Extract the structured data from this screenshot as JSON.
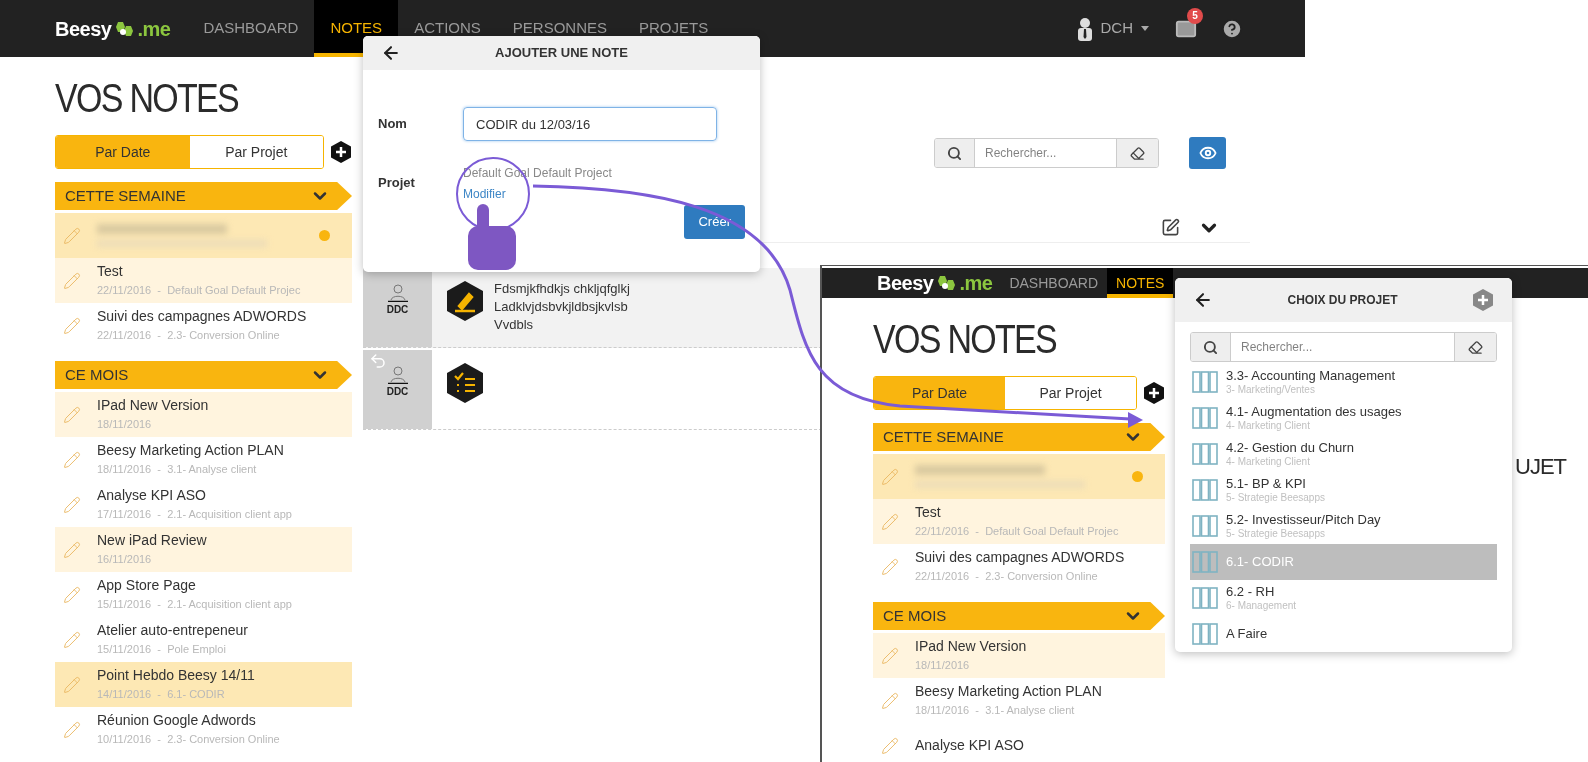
{
  "main_screen": {
    "nav": {
      "logo": {
        "name": "Beesy",
        "suffix": ".me"
      },
      "items": [
        {
          "label": "DASHBOARD",
          "selected": false
        },
        {
          "label": "NOTES",
          "selected": true
        },
        {
          "label": "ACTIONS",
          "selected": false
        },
        {
          "label": "PERSONNES",
          "selected": false
        },
        {
          "label": "PROJETS",
          "selected": false
        }
      ],
      "user": "DCH",
      "mail_badge": "5"
    },
    "notes_panel": {
      "title": "VOS NOTES",
      "toggle": [
        {
          "label": "Par Date",
          "selected": true
        },
        {
          "label": "Par Projet",
          "selected": false
        }
      ],
      "sections": [
        {
          "title": "CETTE SEMAINE",
          "expanded": true,
          "notes": [
            {
              "kind": "blurred",
              "selected": true,
              "tinted": true,
              "unread": true
            },
            {
              "kind": "note",
              "title": "Test",
              "meta": "22/11/2016  -  Default Goal Default Projec",
              "selected": false,
              "tinted": true,
              "unread": false
            },
            {
              "kind": "note",
              "title": "Suivi des campagnes ADWORDS",
              "meta": "22/11/2016  -  2.3- Conversion Online",
              "selected": false,
              "tinted": false,
              "unread": false
            }
          ]
        },
        {
          "title": "CE MOIS",
          "expanded": true,
          "notes": [
            {
              "kind": "note",
              "title": "IPad New Version",
              "meta": "18/11/2016",
              "selected": false,
              "tinted": true,
              "unread": false
            },
            {
              "kind": "note",
              "title": "Beesy Marketing Action PLAN",
              "meta": "18/11/2016  -  3.1- Analyse client",
              "selected": false,
              "tinted": false,
              "unread": false
            },
            {
              "kind": "note",
              "title": "Analyse KPI ASO",
              "meta": "17/11/2016  -  2.1- Acquisition client app",
              "selected": false,
              "tinted": false,
              "unread": false
            },
            {
              "kind": "note",
              "title": "New iPad Review",
              "meta": "16/11/2016",
              "selected": false,
              "tinted": true,
              "unread": false
            },
            {
              "kind": "note",
              "title": "App Store Page",
              "meta": "15/11/2016  -  2.1- Acquisition client app",
              "selected": false,
              "tinted": false,
              "unread": false
            },
            {
              "kind": "note",
              "title": "Atelier auto-entrepeneur",
              "meta": "15/11/2016  -  Pole Emploi",
              "selected": false,
              "tinted": false,
              "unread": false
            },
            {
              "kind": "note",
              "title": "Point Hebdo Beesy 14/11",
              "meta": "14/11/2016  -  6.1- CODIR",
              "selected": true,
              "tinted": true,
              "unread": false
            },
            {
              "kind": "note",
              "title": "Réunion Google Adwords",
              "meta": "10/11/2016  -  2.3- Conversion Online",
              "selected": false,
              "tinted": false,
              "unread": false
            }
          ]
        }
      ]
    },
    "search": {
      "placeholder": "Rechercher..."
    },
    "note_rows": [
      {
        "author": "DDC",
        "kind": "note",
        "reply": false,
        "lines": [
          "Fdsmjkfhdkjs chkljqfglkj",
          "Ladklvjdsbvkjldbsjkvlsb",
          "Vvdbls"
        ]
      },
      {
        "author": "DDC",
        "kind": "action",
        "reply": true
      }
    ]
  },
  "add_note_dialog": {
    "title": "AJOUTER UNE NOTE",
    "name_label": "Nom",
    "name_value": "CODIR du 12/03/16",
    "project_label": "Projet",
    "project_value": "Default Goal Default Project",
    "link": "Modifier",
    "button": "Créer"
  },
  "inset_screen": {
    "nav": {
      "logo": {
        "name": "Beesy",
        "suffix": ".me"
      },
      "items": [
        {
          "label": "DASHBOARD",
          "selected": false
        },
        {
          "label": "NOTES",
          "selected": true
        }
      ]
    },
    "notes_panel": {
      "title": "VOS NOTES",
      "toggle": [
        {
          "label": "Par Date",
          "selected": true
        },
        {
          "label": "Par Projet",
          "selected": false
        }
      ],
      "sections": [
        {
          "title": "CETTE SEMAINE",
          "expanded": true,
          "notes": [
            {
              "kind": "blurred",
              "selected": true,
              "tinted": true,
              "unread": true
            },
            {
              "kind": "note",
              "title": "Test",
              "meta": "22/11/2016  -  Default Goal Default Projec",
              "selected": false,
              "tinted": true,
              "unread": false
            },
            {
              "kind": "note",
              "title": "Suivi des campagnes ADWORDS",
              "meta": "22/11/2016  -  2.3- Conversion Online",
              "selected": false,
              "tinted": false,
              "unread": false
            }
          ]
        },
        {
          "title": "CE MOIS",
          "expanded": true,
          "notes": [
            {
              "kind": "note",
              "title": "IPad New Version",
              "meta": "18/11/2016",
              "selected": false,
              "tinted": true,
              "unread": false
            },
            {
              "kind": "note",
              "title": "Beesy Marketing Action PLAN",
              "meta": "18/11/2016  -  3.1- Analyse client",
              "selected": false,
              "tinted": false,
              "unread": false
            },
            {
              "kind": "note",
              "title": "Analyse KPI ASO",
              "selected": false,
              "tinted": false,
              "unread": false
            }
          ]
        }
      ]
    },
    "heading_fragment": "UJET"
  },
  "project_picker": {
    "title": "CHOIX DU PROJET",
    "placeholder": "Rechercher...",
    "items": [
      {
        "title": "3.3- Accounting Management",
        "subtitle": "3- Marketing/Ventes",
        "selected": false
      },
      {
        "title": "4.1- Augmentation des usages",
        "subtitle": "4- Marketing Client",
        "selected": false
      },
      {
        "title": "4.2- Gestion du Churn",
        "subtitle": "4- Marketing Client",
        "selected": false
      },
      {
        "title": "5.1- BP & KPI",
        "subtitle": "5- Strategie Beesapps",
        "selected": false
      },
      {
        "title": "5.2- Investisseur/Pitch Day",
        "subtitle": "5- Strategie Beesapps",
        "selected": false
      },
      {
        "title": "6.1- CODIR",
        "selected": true
      },
      {
        "title": "6.2 - RH",
        "subtitle": "6- Management",
        "selected": false
      },
      {
        "title": "A Faire",
        "selected": false
      }
    ]
  }
}
